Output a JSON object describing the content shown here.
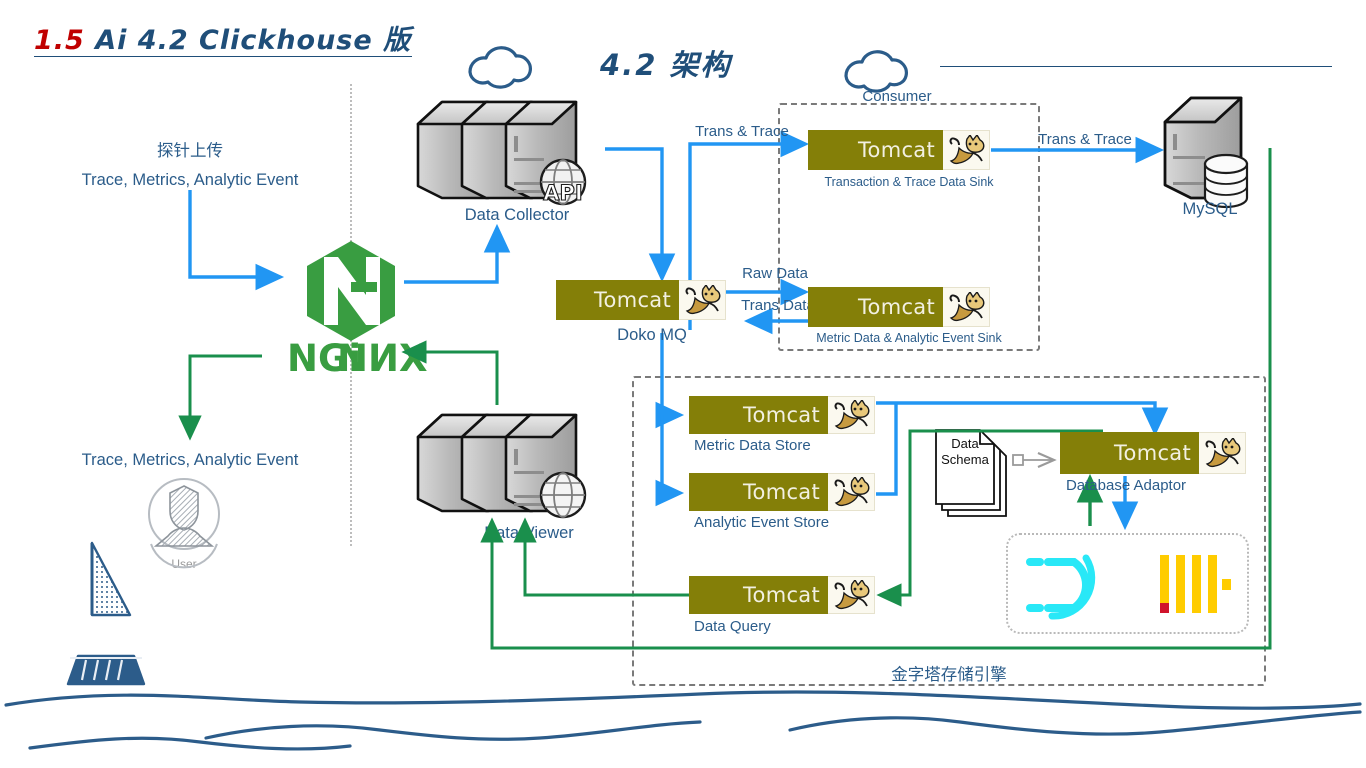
{
  "header": {
    "title_number": "1.5",
    "title_text": "Ai 4.2 Clickhouse 版",
    "center_title": "4.2 架构"
  },
  "left_panel": {
    "upload_label": "探针上传",
    "upload_payload": "Trace, Metrics, Analytic Event",
    "download_payload": "Trace, Metrics, Analytic Event",
    "user_label": "User",
    "gateway_name": "NGINX",
    "gateway_logo": "nginx-logo"
  },
  "nodes": {
    "data_collector": {
      "label": "Data Collector",
      "badge": "API",
      "icon": "server-stack-icon"
    },
    "data_viewer": {
      "label": "Data Viewer",
      "badge": "globe",
      "icon": "server-stack-icon"
    },
    "mysql": {
      "label": "MySQL",
      "icon": "database-server-icon"
    },
    "doko_mq": {
      "product": "Tomcat",
      "label": "Doko MQ"
    },
    "trans_trace_sink": {
      "product": "Tomcat",
      "label": "Transaction & Trace Data Sink"
    },
    "metric_event_sink": {
      "product": "Tomcat",
      "label": "Metric Data & Analytic Event Sink"
    },
    "metric_data_store": {
      "product": "Tomcat",
      "label": "Metric Data Store"
    },
    "analytic_event_store": {
      "product": "Tomcat",
      "label": "Analytic Event Store"
    },
    "data_query": {
      "product": "Tomcat",
      "label": "Data Query"
    },
    "database_adaptor": {
      "product": "Tomcat",
      "label": "Database Adaptor"
    },
    "data_schema": {
      "line1": "Data",
      "line2": "Schema",
      "icon": "document-stack-icon"
    }
  },
  "groups": {
    "consumer": {
      "label": "Consumer",
      "icon": "cloud-icon"
    },
    "storage_engine": {
      "label": "金字塔存储引擎"
    },
    "engines": {
      "druid": "druid-logo",
      "clickhouse": "clickhouse-logo"
    }
  },
  "edges": {
    "trans_trace_to_sink": "Trans & Trace",
    "trans_trace_to_mysql": "Trans & Trace",
    "raw_data": "Raw Data",
    "trans_data": "Trans Data"
  },
  "decoration": {
    "boat": "sailboat-icon",
    "waves": "wave-lines"
  },
  "colors": {
    "ink": "#1f4e79",
    "accent_red": "#c00000",
    "label_blue": "#2b5c8a",
    "flow_blue": "#2196f3",
    "flow_green": "#1a8f4c",
    "tomcat_olive": "#847f08",
    "nginx_green": "#399d41",
    "druid_cyan": "#29e8f7",
    "clickhouse_yellow": "#ffcc00",
    "clickhouse_red": "#d0142c",
    "dash_gray": "#7a7a7a"
  }
}
